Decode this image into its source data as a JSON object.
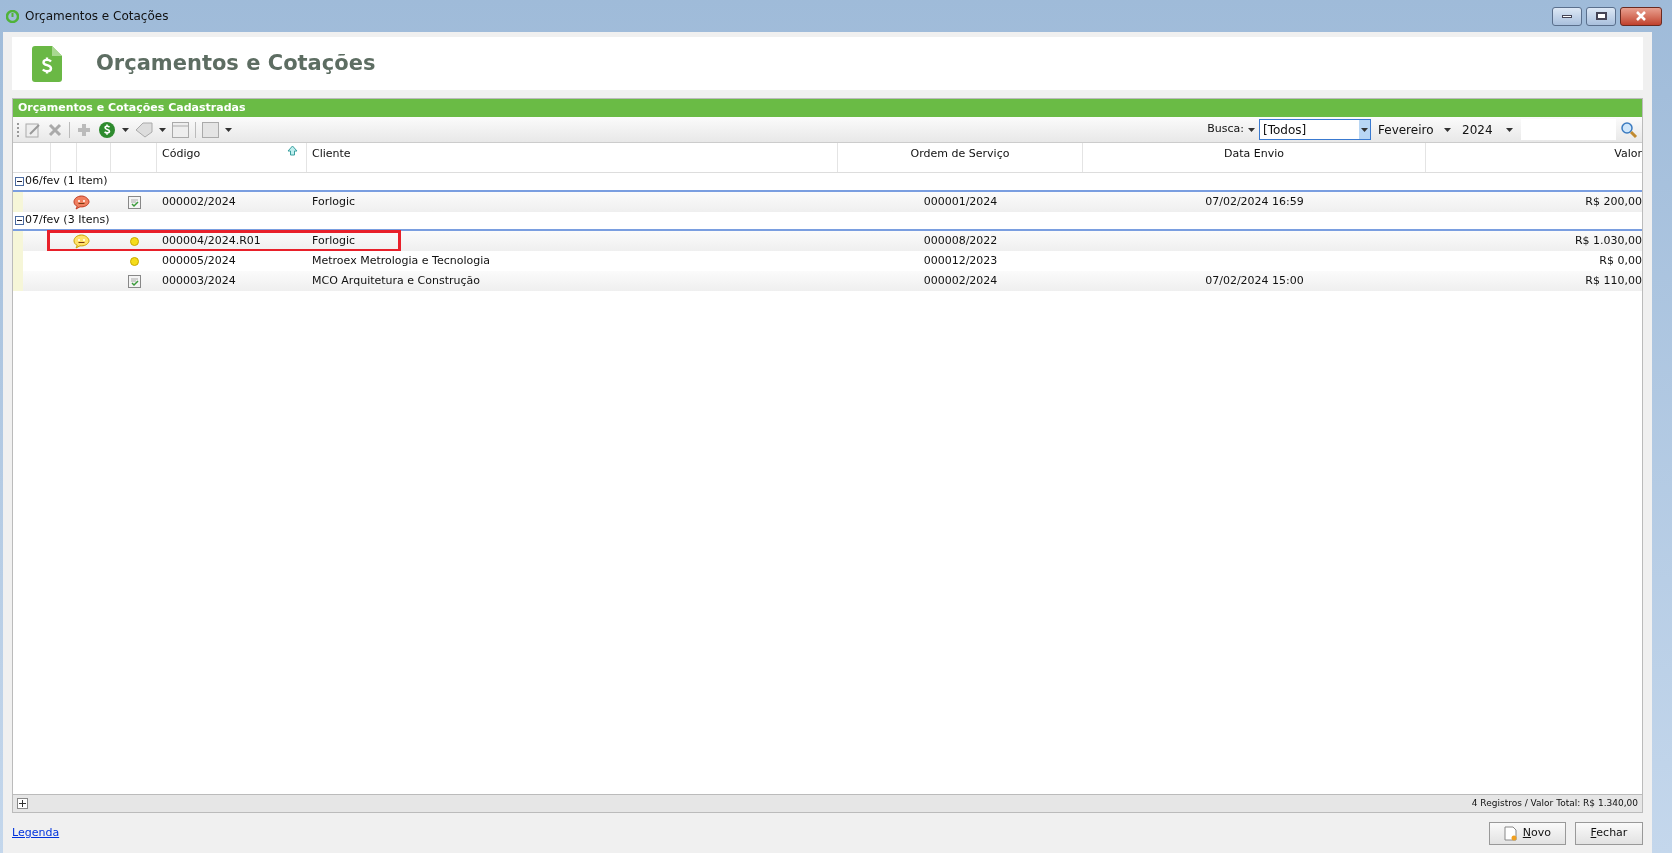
{
  "window": {
    "title": "Orçamentos e Cotações"
  },
  "header": {
    "title": "Orçamentos e Cotações"
  },
  "panel": {
    "title": "Orçamentos e Cotações Cadastradas"
  },
  "search": {
    "label": "Busca:",
    "filter": "[Todos]",
    "month": "Fevereiro",
    "year": "2024"
  },
  "table": {
    "columns": [
      "Código",
      "Cliente",
      "Ordem de Serviço",
      "Data Envio",
      "Valor"
    ],
    "groups": [
      {
        "label": "06/fev (1 Item)",
        "expanded": true,
        "rows": [
          {
            "comment": {
              "kind": "red"
            },
            "status": {
              "kind": "sent"
            },
            "code": "000002/2024",
            "client": "Forlogic",
            "order": "000001/2024",
            "sent_date": "07/02/2024 16:59",
            "value": "R$ 200,00",
            "highlighted": false
          }
        ]
      },
      {
        "label": "07/fev (3 Itens)",
        "expanded": true,
        "rows": [
          {
            "comment": {
              "kind": "yellow"
            },
            "status": {
              "kind": "pending"
            },
            "code": "000004/2024.R01",
            "client": "Forlogic",
            "order": "000008/2022",
            "value": "R$ 1.030,00",
            "highlighted": true
          },
          {
            "status": {
              "kind": "pending"
            },
            "code": "000005/2024",
            "client": "Metroex Metrologia e Tecnologia",
            "order": "000012/2023",
            "value": "R$ 0,00",
            "highlighted": false
          },
          {
            "status": {
              "kind": "sent"
            },
            "code": "000003/2024",
            "client": "MCO Arquitetura e Construção",
            "order": "000002/2024",
            "sent_date": "07/02/2024 15:00",
            "value": "R$ 110,00",
            "highlighted": false
          }
        ]
      }
    ]
  },
  "summary": "4 Registros / Valor Total: R$ 1.340,00",
  "footer": {
    "link": "Legenda",
    "buttons": [
      {
        "kind": "new",
        "label": "Novo"
      },
      {
        "kind": "close",
        "label": "Fechar"
      }
    ]
  }
}
